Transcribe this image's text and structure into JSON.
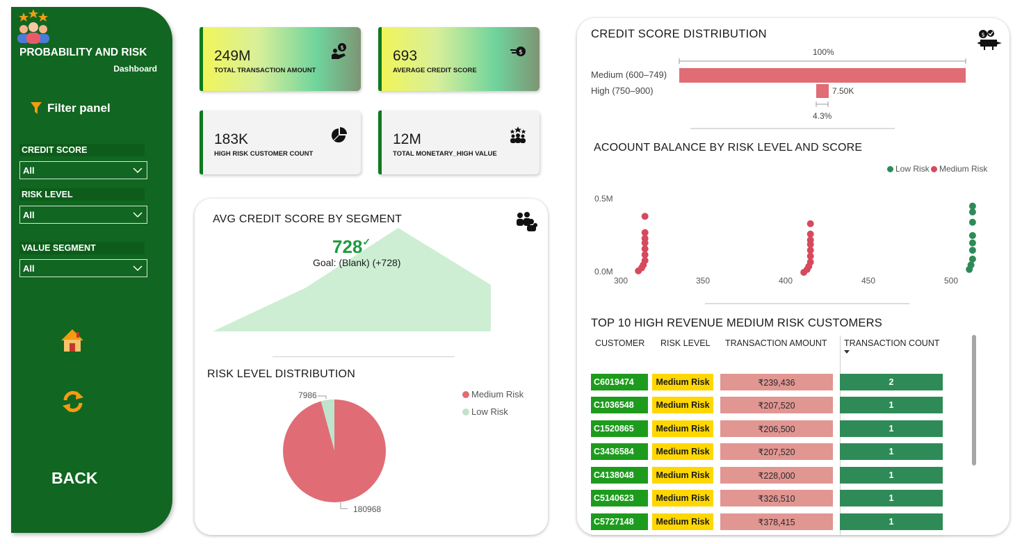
{
  "sidebar": {
    "title": "PROBABILITY AND RISK",
    "subtitle": "Dashboard",
    "filter_panel": "Filter panel",
    "filters": [
      {
        "label": "CREDIT SCORE",
        "value": "All"
      },
      {
        "label": "RISK LEVEL",
        "value": "All"
      },
      {
        "label": "VALUE SEGMENT",
        "value": "All"
      }
    ],
    "back_label": "BACK",
    "colors": {
      "background": "#116621",
      "accent": "#f39c12"
    }
  },
  "kpis": [
    {
      "value": "249M",
      "label": "TOTAL TRANSACTION AMOUNT",
      "icon": "money-hand-icon"
    },
    {
      "value": "693",
      "label": "AVERAGE CREDIT SCORE",
      "icon": "coin-speed-icon"
    },
    {
      "value": "183K",
      "label": "HIGH RISK CUSTOMER COUNT",
      "icon": "pie-chart-icon"
    },
    {
      "value": "12M",
      "label": "TOTAL MONETARY_HIGH VALUE",
      "icon": "team-stars-icon"
    }
  ],
  "avg_credit": {
    "title": "AVG CREDIT SCORE BY SEGMENT",
    "value": "728",
    "check": "✓",
    "goal": "Goal: (Blank) (+728)",
    "area_values": [
      0.0,
      0.42,
      1.0,
      0.45
    ],
    "area_color": "#cdeed2"
  },
  "risk_dist": {
    "title": "RISK LEVEL DISTRIBUTION",
    "legend": [
      {
        "name": "Medium Risk",
        "color": "#e06c75"
      },
      {
        "name": "Low Risk",
        "color": "#bfe3cc"
      }
    ],
    "label_medium": "180968",
    "label_low": "7986"
  },
  "credit_dist": {
    "title": "CREDIT SCORE DISTRIBUTION",
    "bars": [
      {
        "label": "Medium (600–749)",
        "pct": 1.0,
        "value_label": "100%"
      },
      {
        "label": "High (750–900)",
        "pct": 0.043,
        "value_label": "7.50K",
        "pct_label": "4.3%"
      }
    ],
    "bar_color": "#e06c75"
  },
  "scatter": {
    "title": "ACOOUNT BALANCE BY RISK LEVEL AND SCORE",
    "legend": [
      {
        "name": "Low Risk",
        "color": "#2e8b57"
      },
      {
        "name": "Medium Risk",
        "color": "#d64a5e"
      }
    ],
    "y_ticks": [
      "0.5M",
      "0.0M"
    ],
    "x_ticks": [
      "300",
      "350",
      "400",
      "450",
      "500"
    ]
  },
  "chart_data": {
    "type": "scatter",
    "title": "ACOOUNT BALANCE BY RISK LEVEL AND SCORE",
    "xlim": [
      300,
      520
    ],
    "ylim": [
      0,
      0.62
    ],
    "series": [
      {
        "name": "Medium Risk",
        "color": "#d64a5e",
        "points": [
          [
            315,
            0.38
          ],
          [
            315,
            0.27
          ],
          [
            315,
            0.23
          ],
          [
            315,
            0.2
          ],
          [
            315,
            0.16
          ],
          [
            315,
            0.12
          ],
          [
            315,
            0.08
          ],
          [
            314,
            0.05
          ],
          [
            313,
            0.03
          ],
          [
            311,
            0.01
          ],
          [
            415,
            0.33
          ],
          [
            415,
            0.26
          ],
          [
            415,
            0.22
          ],
          [
            415,
            0.19
          ],
          [
            415,
            0.15
          ],
          [
            415,
            0.11
          ],
          [
            415,
            0.07
          ],
          [
            414,
            0.04
          ],
          [
            413,
            0.02
          ],
          [
            411,
            0.0
          ]
        ]
      },
      {
        "name": "Low Risk",
        "color": "#2e8b57",
        "points": [
          [
            513,
            0.45
          ],
          [
            513,
            0.41
          ],
          [
            513,
            0.34
          ],
          [
            513,
            0.25
          ],
          [
            513,
            0.2
          ],
          [
            513,
            0.15
          ],
          [
            513,
            0.09
          ],
          [
            512,
            0.05
          ],
          [
            511,
            0.02
          ]
        ]
      }
    ]
  },
  "top10": {
    "title": "TOP 10 HIGH REVENUE MEDIUM RISK CUSTOMERS",
    "columns": [
      "CUSTOMER",
      "RISK LEVEL",
      "TRANSACTION AMOUNT",
      "TRANSACTION COUNT"
    ],
    "rows": [
      {
        "customer": "C6019474",
        "risk": "Medium Risk",
        "amount": "₹239,436",
        "count": "2"
      },
      {
        "customer": "C1036548",
        "risk": "Medium Risk",
        "amount": "₹207,520",
        "count": "1"
      },
      {
        "customer": "C1520865",
        "risk": "Medium Risk",
        "amount": "₹206,500",
        "count": "1"
      },
      {
        "customer": "C3436584",
        "risk": "Medium Risk",
        "amount": "₹207,520",
        "count": "1"
      },
      {
        "customer": "C4138048",
        "risk": "Medium Risk",
        "amount": "₹228,000",
        "count": "1"
      },
      {
        "customer": "C5140623",
        "risk": "Medium Risk",
        "amount": "₹326,510",
        "count": "1"
      },
      {
        "customer": "C5727148",
        "risk": "Medium Risk",
        "amount": "₹378,415",
        "count": "1"
      }
    ]
  }
}
